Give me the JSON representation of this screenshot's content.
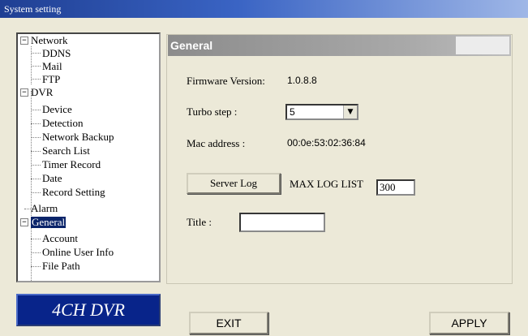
{
  "window": {
    "title": "System setting"
  },
  "tree": {
    "network": "Network",
    "ddns": "DDNS",
    "mail": "Mail",
    "ftp": "FTP",
    "dvr": "DVR",
    "device": "Device",
    "detection": "Detection",
    "network_backup": "Network Backup",
    "search_list": "Search List",
    "timer_record": "Timer Record",
    "date": "Date",
    "record_setting": "Record Setting",
    "alarm": "Alarm",
    "general": "General",
    "account": "Account",
    "online_user_info": "Online User Info",
    "file_path": "File Path",
    "expand_symbol": "⊟",
    "selected_color": "#0a246a"
  },
  "logo": {
    "text": "4CH DVR",
    "bg_color": "#08248a"
  },
  "panel": {
    "title": "General",
    "firmware_label": "Firmware Version:",
    "firmware_value": "1.0.8.8",
    "turbo_label": "Turbo step :",
    "turbo_value": "5",
    "dropdown_icon": "chevron-down-icon",
    "mac_label": "Mac address :",
    "mac_value": "00:0e:53:02:36:84",
    "server_log_label": "Server Log",
    "max_log_label": "MAX LOG LIST",
    "max_log_value": "300",
    "title_label": "Title :",
    "title_value": ""
  },
  "buttons": {
    "exit": "EXIT",
    "apply": "APPLY"
  }
}
